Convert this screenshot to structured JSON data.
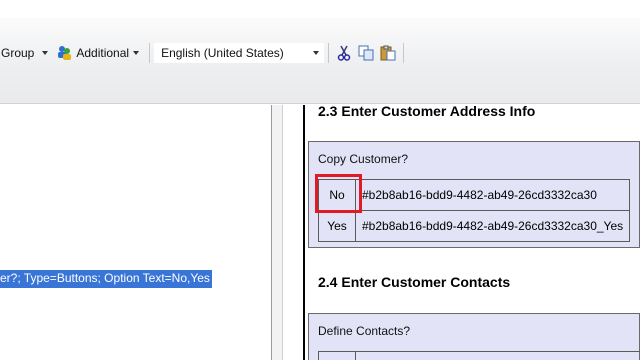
{
  "toolbar": {
    "group_label": "Group",
    "additional_label": "Additional",
    "language_value": "English (United States)"
  },
  "left_pane": {
    "selected_text": "er?; Type=Buttons; Option Text=No,Yes"
  },
  "document": {
    "section_2_3": {
      "title": "2.3 Enter Customer Address Info",
      "question": "Copy Customer?",
      "options": [
        {
          "label": "No",
          "value": "#b2b8ab16-bdd9-4482-ab49-26cd3332ca30"
        },
        {
          "label": "Yes",
          "value": "#b2b8ab16-bdd9-4482-ab49-26cd3332ca30_Yes"
        }
      ]
    },
    "section_2_4": {
      "title": "2.4 Enter Customer Contacts",
      "question": "Define Contacts?"
    }
  },
  "colors": {
    "selection": "#3875d7",
    "box_fill": "#e3e3f7",
    "highlight": "#e01b24"
  }
}
